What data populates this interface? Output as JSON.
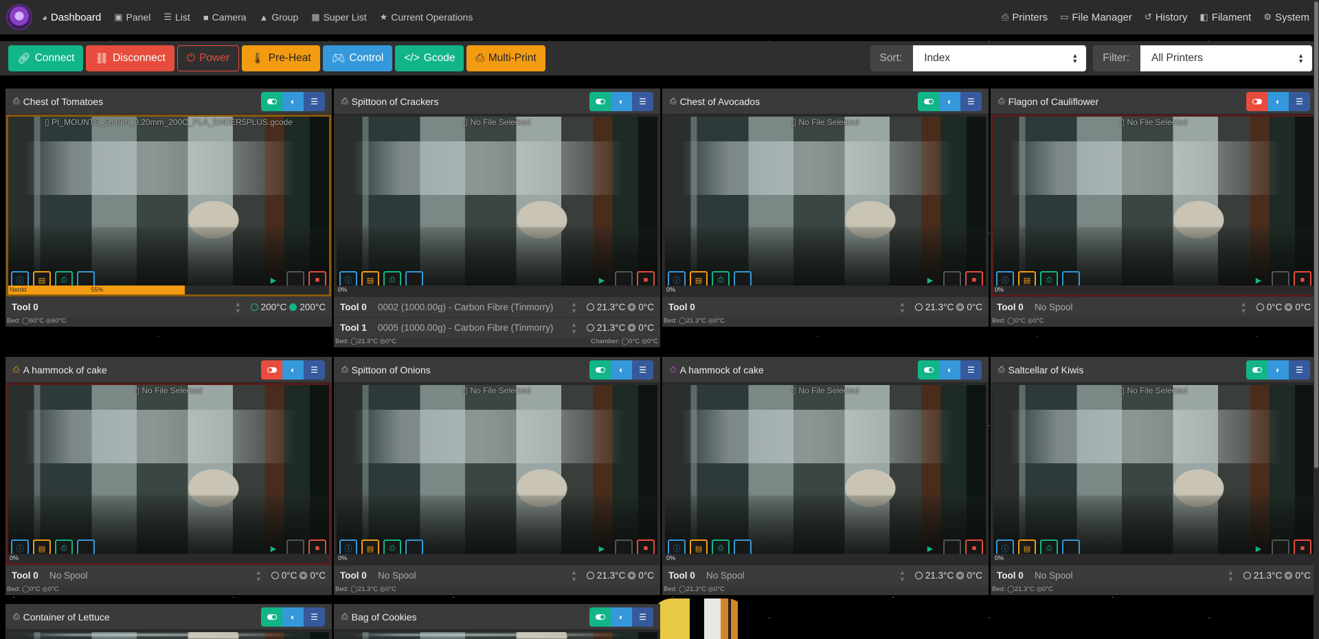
{
  "nav": {
    "left": [
      {
        "label": "Dashboard",
        "icon": "tachometer-icon",
        "glyph": "◕"
      },
      {
        "label": "Panel",
        "icon": "window-icon",
        "glyph": "▣"
      },
      {
        "label": "List",
        "icon": "list-icon",
        "glyph": "☰"
      },
      {
        "label": "Camera",
        "icon": "camera-icon",
        "glyph": "■"
      },
      {
        "label": "Group",
        "icon": "group-icon",
        "glyph": "▲"
      },
      {
        "label": "Super List",
        "icon": "grid-icon",
        "glyph": "▦"
      },
      {
        "label": "Current Operations",
        "icon": "star-icon",
        "glyph": "★"
      }
    ],
    "right": [
      {
        "label": "Printers",
        "icon": "printer-icon",
        "glyph": "⎙"
      },
      {
        "label": "File Manager",
        "icon": "folder-icon",
        "glyph": "▭"
      },
      {
        "label": "History",
        "icon": "history-icon",
        "glyph": "↺"
      },
      {
        "label": "Filament",
        "icon": "spool-icon",
        "glyph": "◧"
      },
      {
        "label": "System",
        "icon": "gears-icon",
        "glyph": "⚙"
      }
    ]
  },
  "toolbar": {
    "connect": "Connect",
    "disconnect": "Disconnect",
    "power": "Power",
    "preheat": "Pre-Heat",
    "control": "Control",
    "gcode": "Gcode",
    "multiprint": "Multi-Print",
    "sort_label": "Sort:",
    "sort_value": "Index",
    "filter_label": "Filter:",
    "filter_value": "All Printers"
  },
  "colors": {
    "green": "#11b588",
    "red": "#e74c3c",
    "orange": "#f39c12",
    "blue": "#3498db"
  },
  "printers": [
    {
      "name": "Chest of Tomatoes",
      "file": "PI_MOUNTS_5h49m_0.20mm_200C_PLA_ENDER5PLUS.gcode",
      "progress": "55%",
      "progress_value": 0.55,
      "progress_side": "Nerdd",
      "tools": [
        {
          "name": "Tool 0",
          "spool": "",
          "temps": "200°C",
          "target": "200°C"
        }
      ],
      "bed": "Bed:",
      "bed_actual": "60°C",
      "bed_target": "60°C",
      "chamber": ""
    },
    {
      "name": "Spittoon of Crackers",
      "file": "No File Selected",
      "progress": "0%",
      "tools": [
        {
          "name": "Tool 0",
          "spool": "0002 (1000.00g) - Carbon Fibre (Tinmorry)",
          "temps": "21.3°C",
          "target": "0°C"
        },
        {
          "name": "Tool 1",
          "spool": "0005 (1000.00g) - Carbon Fibre (Tinmorry)",
          "temps": "21.3°C",
          "target": "0°C"
        }
      ],
      "bed": "Bed:",
      "bed_actual": "21.3°C",
      "bed_target": "0°C",
      "chamber": "Chamber:",
      "chamber_actual": "0°C",
      "chamber_target": "0°C"
    },
    {
      "name": "Chest of Avocados",
      "file": "No File Selected",
      "progress": "0%",
      "tools": [
        {
          "name": "Tool 0",
          "spool": "",
          "temps": "21.3°C",
          "target": "0°C"
        }
      ],
      "bed": "Bed:",
      "bed_actual": "21.3°C",
      "bed_target": "0°C",
      "chamber": ""
    },
    {
      "name": "Flagon of Cauliflower",
      "file": "No File Selected",
      "progress": "0%",
      "tools": [
        {
          "name": "Tool 0",
          "spool": "No Spool",
          "temps": "0°C",
          "target": "0°C"
        }
      ],
      "bed": "Bed:",
      "bed_actual": "0°C",
      "bed_target": "0°C",
      "chamber": ""
    },
    {
      "name": "A hammock of cake",
      "file": "No File Selected",
      "progress": "0%",
      "tools": [
        {
          "name": "Tool 0",
          "spool": "No Spool",
          "temps": "0°C",
          "target": "0°C"
        }
      ],
      "bed": "Bed:",
      "bed_actual": "0°C",
      "bed_target": "0°C",
      "chamber": ""
    },
    {
      "name": "Spittoon of Onions",
      "file": "No File Selected",
      "progress": "0%",
      "tools": [
        {
          "name": "Tool 0",
          "spool": "No Spool",
          "temps": "21.3°C",
          "target": "0°C"
        }
      ],
      "bed": "Bed:",
      "bed_actual": "21.3°C",
      "bed_target": "0°C",
      "chamber": ""
    },
    {
      "name": "A hammock of cake",
      "file": "No File Selected",
      "progress": "0%",
      "tools": [
        {
          "name": "Tool 0",
          "spool": "No Spool",
          "temps": "21.3°C",
          "target": "0°C"
        }
      ],
      "bed": "Bed:",
      "bed_actual": "21.3°C",
      "bed_target": "0°C",
      "chamber": ""
    },
    {
      "name": "Saltcellar of Kiwis",
      "file": "No File Selected",
      "progress": "0%",
      "tools": [
        {
          "name": "Tool 0",
          "spool": "No Spool",
          "temps": "21.3°C",
          "target": "0°C"
        }
      ],
      "bed": "Bed:",
      "bed_actual": "21.3°C",
      "bed_target": "0°C",
      "chamber": ""
    },
    {
      "name": "Container of Lettuce"
    },
    {
      "name": "Bag of Cookies"
    }
  ]
}
